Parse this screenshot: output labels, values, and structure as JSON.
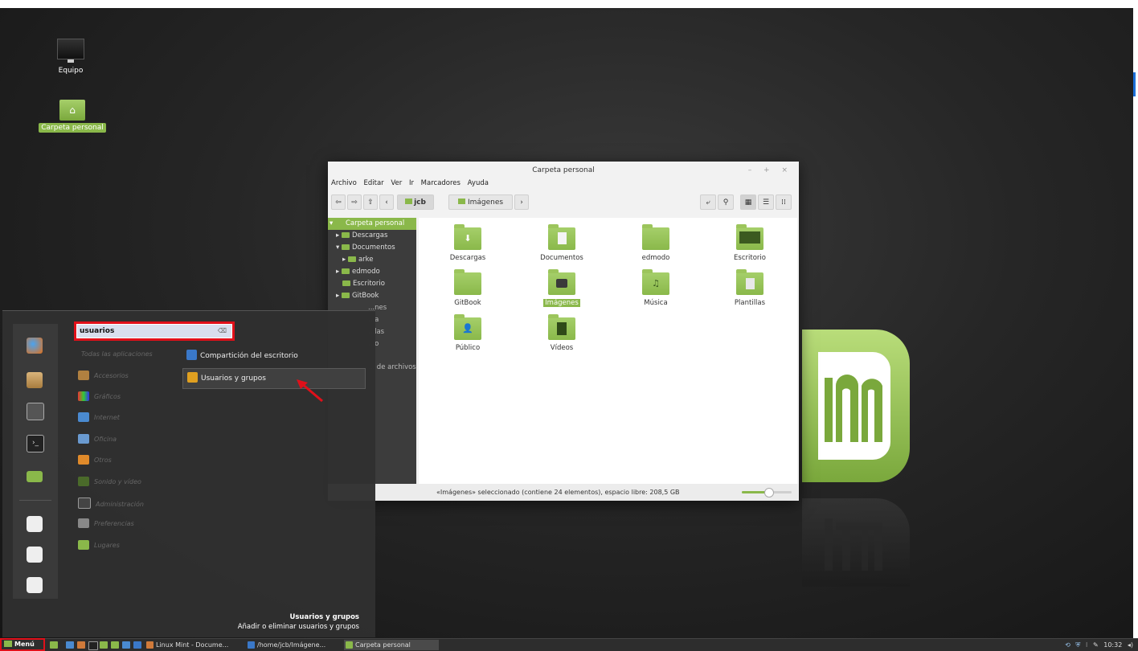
{
  "desktop": {
    "icons": [
      {
        "label": "Equipo"
      },
      {
        "label": "Carpeta personal"
      }
    ]
  },
  "file_manager": {
    "title": "Carpeta personal",
    "window_controls": "– + ×",
    "menubar": [
      "Archivo",
      "Editar",
      "Ver",
      "Ir",
      "Marcadores",
      "Ayuda"
    ],
    "breadcrumbs": [
      "jcb",
      "Imágenes"
    ],
    "sidebar": [
      {
        "label": "Carpeta personal",
        "selected": true
      },
      {
        "label": "Descargas"
      },
      {
        "label": "Documentos"
      },
      {
        "label": "arke"
      },
      {
        "label": "edmodo"
      },
      {
        "label": "Escritorio"
      },
      {
        "label": "GitBook"
      },
      {
        "label": "...nes"
      },
      {
        "label": "...a"
      },
      {
        "label": "...las"
      },
      {
        "label": "...o"
      },
      {
        "label": "... de archivos"
      }
    ],
    "folders": [
      {
        "label": "Descargas",
        "icon": "download-icon"
      },
      {
        "label": "Documentos",
        "icon": "document-icon"
      },
      {
        "label": "edmodo",
        "icon": "folder-icon"
      },
      {
        "label": "Escritorio",
        "icon": "desktop-icon"
      },
      {
        "label": "GitBook",
        "icon": "folder-icon"
      },
      {
        "label": "Imágenes",
        "icon": "camera-icon",
        "selected": true
      },
      {
        "label": "Música",
        "icon": "music-icon"
      },
      {
        "label": "Plantillas",
        "icon": "template-icon"
      },
      {
        "label": "Público",
        "icon": "person-icon"
      },
      {
        "label": "Vídeos",
        "icon": "film-icon"
      }
    ],
    "status": "«Imágenes» seleccionado (contiene 24 elementos), espacio libre: 208,5 GB"
  },
  "menu": {
    "search_value": "usuarios",
    "all_apps_label": "Todas las aplicaciones",
    "categories": [
      "Accesorios",
      "Gráficos",
      "Internet",
      "Oficina",
      "Otros",
      "Sonido y vídeo",
      "Administración",
      "Preferencias",
      "Lugares"
    ],
    "results": [
      {
        "label": "Compartición del escritorio"
      },
      {
        "label": "Usuarios y grupos",
        "highlighted": true
      }
    ],
    "desc_title": "Usuarios y grupos",
    "desc_text": "Añadir o eliminar usuarios y grupos"
  },
  "taskbar": {
    "menu_label": "Menú",
    "windows": [
      "Linux Mint - Docume...",
      "/home/jcb/Imágene...",
      "Carpeta personal"
    ],
    "clock": "10:32"
  },
  "colors": {
    "accent": "#8ab84a",
    "highlight_border": "#e0101a"
  }
}
